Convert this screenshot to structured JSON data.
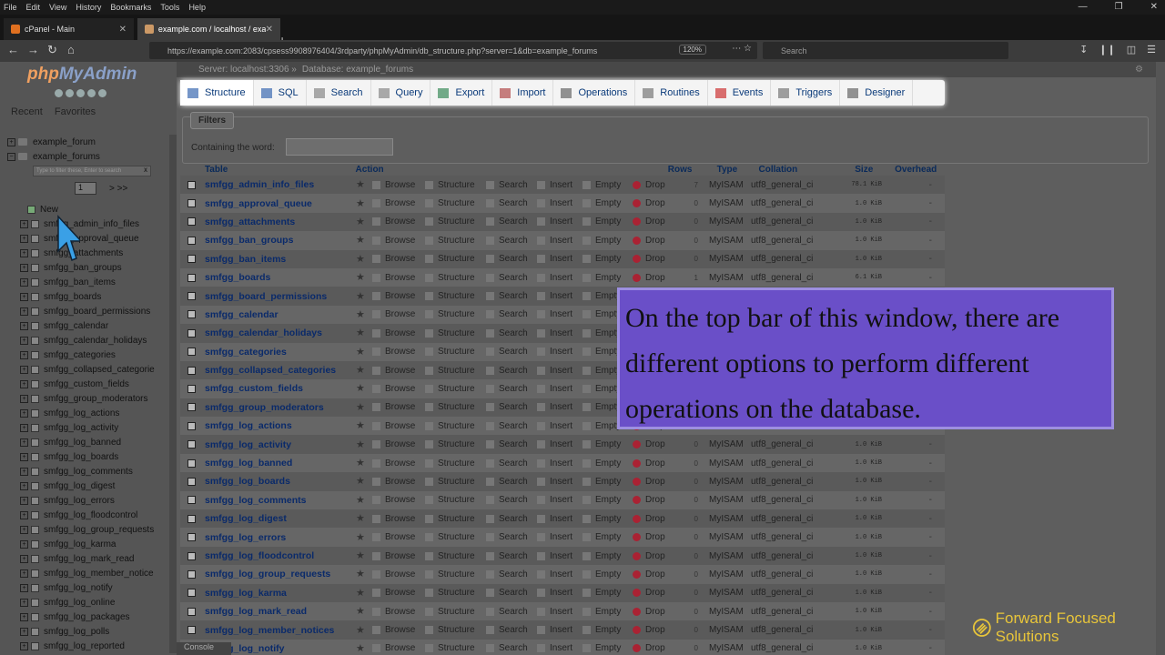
{
  "browser": {
    "menu": [
      "File",
      "Edit",
      "View",
      "History",
      "Bookmarks",
      "Tools",
      "Help"
    ],
    "tabs": [
      {
        "title": "cPanel - Main"
      },
      {
        "title": "example.com / localhost / exa"
      }
    ],
    "url": "https://example.com:2083/cpsess9908976404/3rdparty/phpMyAdmin/db_structure.php?server=1&db=example_forums",
    "zoom": "120%",
    "search_placeholder": "Search"
  },
  "sidebar": {
    "logo_php": "php",
    "logo_myadmin": "MyAdmin",
    "links": [
      "Recent",
      "Favorites"
    ],
    "databases": [
      "example_forum",
      "example_forums"
    ],
    "filter_placeholder": "Type to filter these, Enter to search",
    "filter_clear": "X",
    "page_value": "1",
    "page_next": "> >>",
    "new_label": "New",
    "tables": [
      "smfgg_admin_info_files",
      "smfgg_approval_queue",
      "smfgg_attachments",
      "smfgg_ban_groups",
      "smfgg_ban_items",
      "smfgg_boards",
      "smfgg_board_permissions",
      "smfgg_calendar",
      "smfgg_calendar_holidays",
      "smfgg_categories",
      "smfgg_collapsed_categorie",
      "smfgg_custom_fields",
      "smfgg_group_moderators",
      "smfgg_log_actions",
      "smfgg_log_activity",
      "smfgg_log_banned",
      "smfgg_log_boards",
      "smfgg_log_comments",
      "smfgg_log_digest",
      "smfgg_log_errors",
      "smfgg_log_floodcontrol",
      "smfgg_log_group_requests",
      "smfgg_log_karma",
      "smfgg_log_mark_read",
      "smfgg_log_member_notice",
      "smfgg_log_notify",
      "smfgg_log_online",
      "smfgg_log_packages",
      "smfgg_log_polls",
      "smfgg_log_reported"
    ]
  },
  "breadcrumb": {
    "server": "Server: localhost:3306 »",
    "database": "Database: example_forums"
  },
  "topbar": [
    "Structure",
    "SQL",
    "Search",
    "Query",
    "Export",
    "Import",
    "Operations",
    "Routines",
    "Events",
    "Triggers",
    "Designer"
  ],
  "filters": {
    "legend": "Filters",
    "label": "Containing the word:"
  },
  "table": {
    "headers": {
      "table": "Table",
      "action": "Action",
      "rows": "Rows",
      "type": "Type",
      "collation": "Collation",
      "size": "Size",
      "overhead": "Overhead"
    },
    "actions": {
      "browse": "Browse",
      "structure": "Structure",
      "search": "Search",
      "insert": "Insert",
      "empty": "Empty",
      "drop": "Drop"
    },
    "rows": [
      {
        "name": "smfgg_admin_info_files",
        "rows": "7",
        "type": "MyISAM",
        "collation": "utf8_general_ci",
        "size": "78.1 KiB",
        "overhead": "-"
      },
      {
        "name": "smfgg_approval_queue",
        "rows": "0",
        "type": "MyISAM",
        "collation": "utf8_general_ci",
        "size": "1.0 KiB",
        "overhead": "-"
      },
      {
        "name": "smfgg_attachments",
        "rows": "0",
        "type": "MyISAM",
        "collation": "utf8_general_ci",
        "size": "1.0 KiB",
        "overhead": "-"
      },
      {
        "name": "smfgg_ban_groups",
        "rows": "0",
        "type": "MyISAM",
        "collation": "utf8_general_ci",
        "size": "1.0 KiB",
        "overhead": "-"
      },
      {
        "name": "smfgg_ban_items",
        "rows": "0",
        "type": "MyISAM",
        "collation": "utf8_general_ci",
        "size": "1.0 KiB",
        "overhead": "-"
      },
      {
        "name": "smfgg_boards",
        "rows": "1",
        "type": "MyISAM",
        "collation": "utf8_general_ci",
        "size": "6.1 KiB",
        "overhead": "-"
      },
      {
        "name": "smfgg_board_permissions",
        "rows": "",
        "type": "",
        "collation": "",
        "size": "",
        "overhead": ""
      },
      {
        "name": "smfgg_calendar",
        "rows": "",
        "type": "",
        "collation": "",
        "size": "",
        "overhead": ""
      },
      {
        "name": "smfgg_calendar_holidays",
        "rows": "",
        "type": "",
        "collation": "",
        "size": "",
        "overhead": ""
      },
      {
        "name": "smfgg_categories",
        "rows": "",
        "type": "",
        "collation": "",
        "size": "",
        "overhead": ""
      },
      {
        "name": "smfgg_collapsed_categories",
        "rows": "",
        "type": "",
        "collation": "",
        "size": "",
        "overhead": ""
      },
      {
        "name": "smfgg_custom_fields",
        "rows": "",
        "type": "",
        "collation": "",
        "size": "",
        "overhead": ""
      },
      {
        "name": "smfgg_group_moderators",
        "rows": "",
        "type": "",
        "collation": "",
        "size": "",
        "overhead": ""
      },
      {
        "name": "smfgg_log_actions",
        "rows": "",
        "type": "",
        "collation": "",
        "size": "",
        "overhead": ""
      },
      {
        "name": "smfgg_log_activity",
        "rows": "0",
        "type": "MyISAM",
        "collation": "utf8_general_ci",
        "size": "1.0 KiB",
        "overhead": "-"
      },
      {
        "name": "smfgg_log_banned",
        "rows": "0",
        "type": "MyISAM",
        "collation": "utf8_general_ci",
        "size": "1.0 KiB",
        "overhead": "-"
      },
      {
        "name": "smfgg_log_boards",
        "rows": "0",
        "type": "MyISAM",
        "collation": "utf8_general_ci",
        "size": "1.0 KiB",
        "overhead": "-"
      },
      {
        "name": "smfgg_log_comments",
        "rows": "0",
        "type": "MyISAM",
        "collation": "utf8_general_ci",
        "size": "1.0 KiB",
        "overhead": "-"
      },
      {
        "name": "smfgg_log_digest",
        "rows": "0",
        "type": "MyISAM",
        "collation": "utf8_general_ci",
        "size": "1.0 KiB",
        "overhead": "-"
      },
      {
        "name": "smfgg_log_errors",
        "rows": "0",
        "type": "MyISAM",
        "collation": "utf8_general_ci",
        "size": "1.0 KiB",
        "overhead": "-"
      },
      {
        "name": "smfgg_log_floodcontrol",
        "rows": "0",
        "type": "MyISAM",
        "collation": "utf8_general_ci",
        "size": "1.0 KiB",
        "overhead": "-"
      },
      {
        "name": "smfgg_log_group_requests",
        "rows": "0",
        "type": "MyISAM",
        "collation": "utf8_general_ci",
        "size": "1.0 KiB",
        "overhead": "-"
      },
      {
        "name": "smfgg_log_karma",
        "rows": "0",
        "type": "MyISAM",
        "collation": "utf8_general_ci",
        "size": "1.0 KiB",
        "overhead": "-"
      },
      {
        "name": "smfgg_log_mark_read",
        "rows": "0",
        "type": "MyISAM",
        "collation": "utf8_general_ci",
        "size": "1.0 KiB",
        "overhead": "-"
      },
      {
        "name": "smfgg_log_member_notices",
        "rows": "0",
        "type": "MyISAM",
        "collation": "utf8_general_ci",
        "size": "1.0 KiB",
        "overhead": "-"
      },
      {
        "name": "smfgg_log_notify",
        "rows": "0",
        "type": "MyISAM",
        "collation": "utf8_general_ci",
        "size": "1.0 KiB",
        "overhead": "-"
      }
    ]
  },
  "console_label": "Console",
  "callout": "On the top bar of this window, there are different options to perform different operations on the database.",
  "brand": "Forward Focused Solutions"
}
